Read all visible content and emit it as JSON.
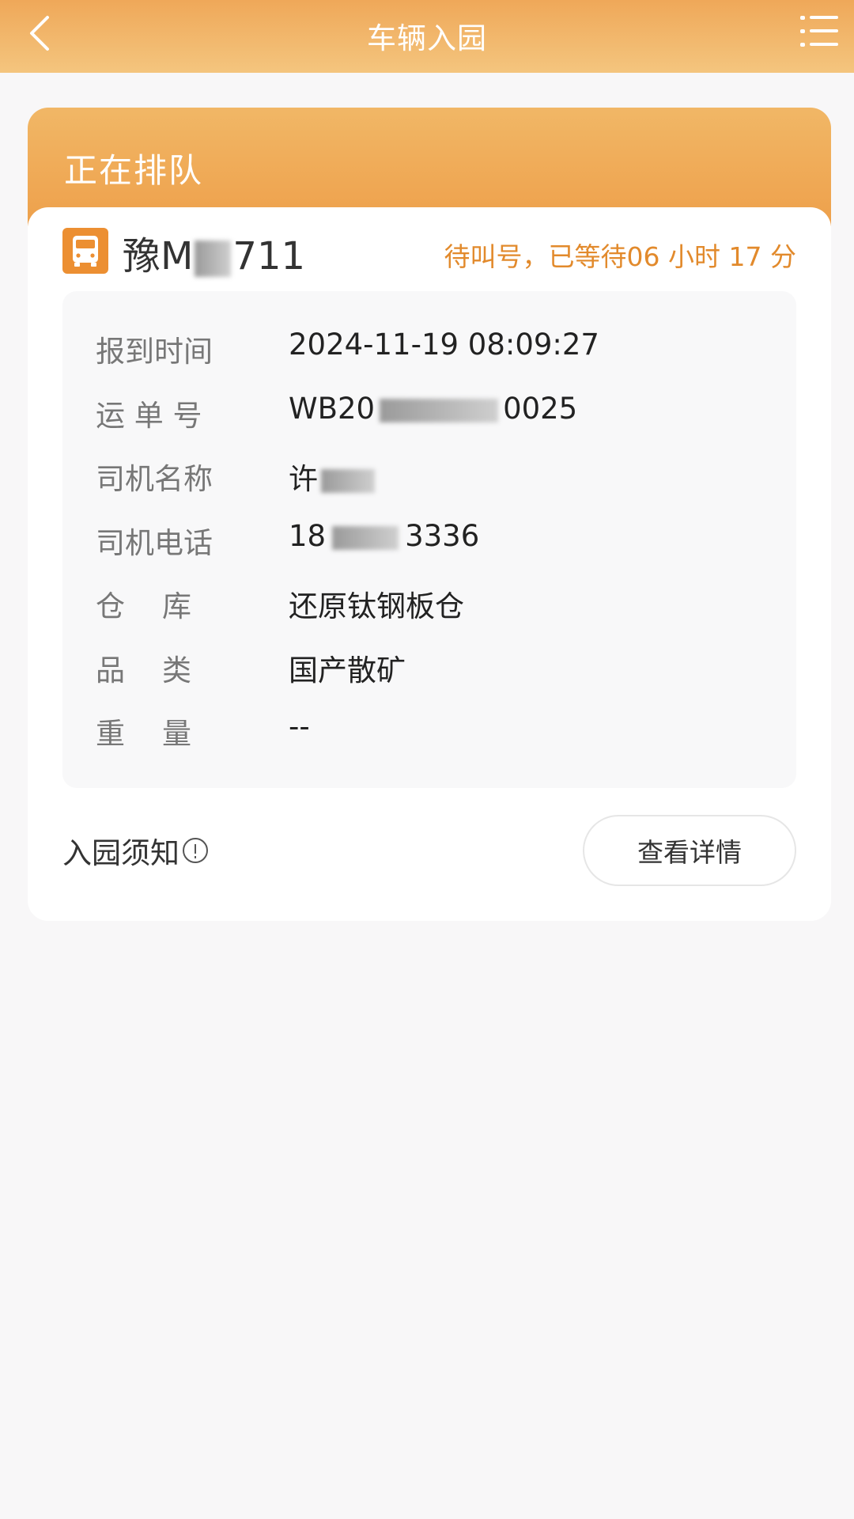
{
  "nav": {
    "title": "车辆入园",
    "back_icon": "chevron-left-icon",
    "menu_icon": "list-menu-icon"
  },
  "queue": {
    "title": "正在排队",
    "plate_prefix": "豫M",
    "plate_suffix": "711",
    "status": "待叫号，已等待06 小时 17 分",
    "truck_icon": "truck-icon"
  },
  "details": [
    {
      "label": "报到时间",
      "value": "2024-11-19 08:09:27"
    },
    {
      "label": "运 单 号",
      "value": "WB20",
      "value_tail": "0025"
    },
    {
      "label": "司机名称",
      "value": "许"
    },
    {
      "label": "司机电话",
      "value": "18",
      "value_tail": "3336"
    },
    {
      "label": "仓    库",
      "value": "还原钛钢板仓"
    },
    {
      "label": "品    类",
      "value": "国产散矿"
    },
    {
      "label": "重    量",
      "value": "--"
    }
  ],
  "footer": {
    "notice_label": "入园须知",
    "notice_icon": "info-circle-icon",
    "detail_button": "查看详情"
  },
  "colors": {
    "accent": "#ee9f4a",
    "status_text": "#e28a2c",
    "header_gradient_top": "#f1b766"
  }
}
